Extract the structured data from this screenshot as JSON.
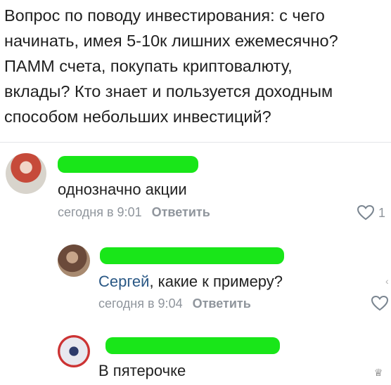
{
  "post": {
    "text": "Вопрос по поводу инвестирования: с чего\nначинать, имея 5-10к лишних ежемесячно?\nПАММ счета, покупать криптовалюту,\nвклады? Кто знает и пользуется доходным\nспособом небольших инвестиций?"
  },
  "comments": [
    {
      "author": "",
      "mention": "",
      "text": "однозначно акции",
      "time": "сегодня в 9:01",
      "reply_label": "Ответить",
      "likes": "1"
    },
    {
      "author": "",
      "mention": "Сергей",
      "text": ", какие к примеру?",
      "time": "сегодня в 9:04",
      "reply_label": "Ответить",
      "likes": ""
    },
    {
      "author": "",
      "mention": "",
      "text": "В пятерочке",
      "time": "",
      "reply_label": "",
      "likes": ""
    }
  ],
  "icons": {
    "like": "heart-outline-icon",
    "bottom_right": "tag-icon"
  },
  "colors": {
    "redaction": "#19e619",
    "mention": "#2a5885",
    "meta": "#8f959c"
  }
}
